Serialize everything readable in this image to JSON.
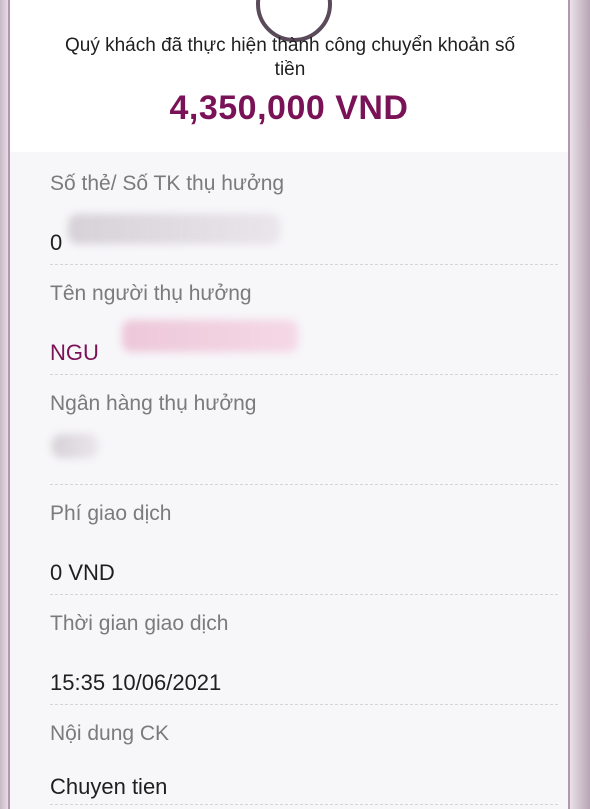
{
  "message": "Quý khách đã thực hiện thành công chuyển khoản số tiền",
  "amount": "4,350,000 VND",
  "details": {
    "account_number": {
      "label": "Số thẻ/ Số TK thụ hưởng",
      "value": "0"
    },
    "beneficiary_name": {
      "label": "Tên người thụ hưởng",
      "value": "NGU"
    },
    "bank": {
      "label": "Ngân hàng thụ hưởng",
      "value": ""
    },
    "fee": {
      "label": "Phí giao dịch",
      "value": "0 VND"
    },
    "time": {
      "label": "Thời gian giao dịch",
      "value": "15:35 10/06/2021"
    },
    "content": {
      "label": "Nội dung CK",
      "value": "Chuyen tien"
    }
  },
  "colors": {
    "accent": "#7a1258",
    "label_gray": "#7b7b7b",
    "details_bg": "#f7f6f8"
  },
  "icons": {
    "top": "success-check-icon"
  }
}
